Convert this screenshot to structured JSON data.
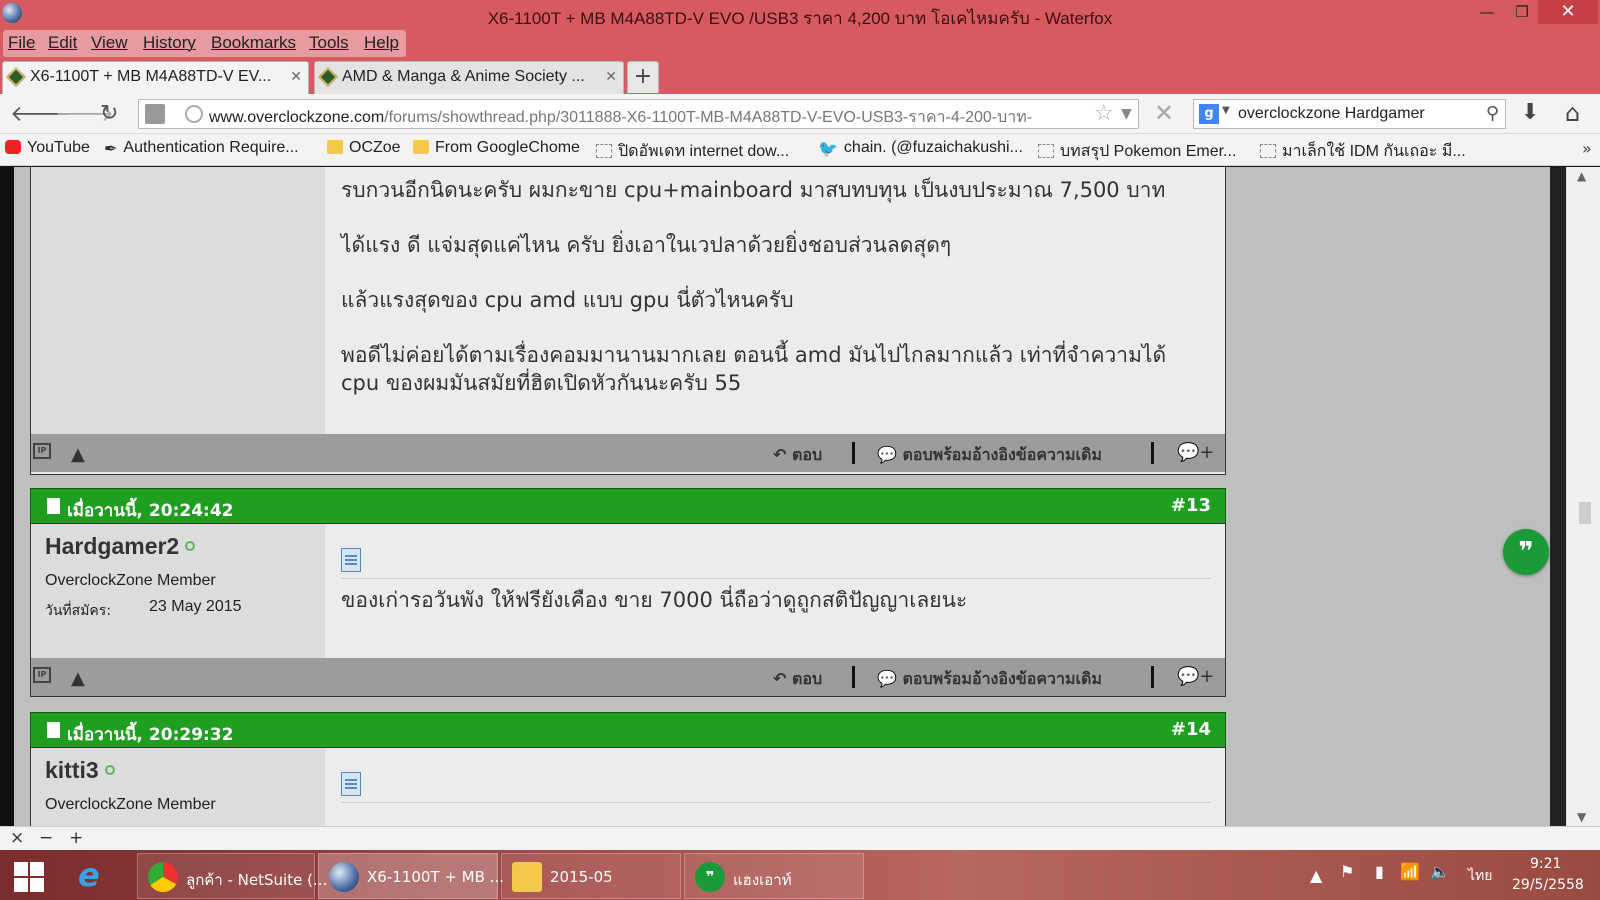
{
  "window": {
    "title": "X6-1100T + MB M4A88TD-V EVO /USB3 ราคา 4,200 บาท โอเคไหมครับ - Waterfox",
    "minimize": "—",
    "maximize": "❐",
    "close": "✕"
  },
  "menu": {
    "items": [
      "File",
      "Edit",
      "View",
      "History",
      "Bookmarks",
      "Tools",
      "Help"
    ]
  },
  "tabs": [
    {
      "label": "X6-1100T + MB M4A88TD-V EV...",
      "active": true
    },
    {
      "label": "AMD & Manga & Anime Society ...",
      "active": false
    }
  ],
  "new_tab": "+",
  "nav": {
    "back": "🡐",
    "forward": "🡒",
    "reload": "↻",
    "url_domain": "www.overclockzone.com",
    "url_rest": "/forums/showthread.php/3011888-X6-1100T-MB-M4A88TD-V-EVO-USB3-ราคา-4-200-บาท-",
    "stop": "✕",
    "search_text": "overclockzone Hardgamer",
    "search_engine_letter": "g"
  },
  "bookmarks": [
    {
      "label": "YouTube",
      "icon": "youtube-icon"
    },
    {
      "label": "Authentication Require...",
      "icon": "pen-icon"
    },
    {
      "label": "OCZoe",
      "icon": "folder-icon"
    },
    {
      "label": "From GoogleChome",
      "icon": "folder-icon"
    },
    {
      "label": "ปิดอัพเดท internet dow...",
      "icon": "blank-page-icon"
    },
    {
      "label": "chain. (@fuzaichakushi...",
      "icon": "twitter-icon"
    },
    {
      "label": "บทสรุป Pokemon Emer...",
      "icon": "blank-page-icon"
    },
    {
      "label": "มาเล็กใช้ IDM กันเถอะ มี...",
      "icon": "blank-page-icon"
    }
  ],
  "bookmarks_more": "»",
  "posts": [
    {
      "lines": [
        "รบกวนอีกนิดนะครับ ผมกะขาย cpu+mainboard มาสบทบทุน เป็นงบประมาณ 7,500 บาท",
        "ได้แรง ดี แจ่มสุดแค่ไหน ครับ ยิ่งเอาในเวปลาด้วยยิ่งชอบส่วนลดสุดๆ",
        "แล้วแรงสุดของ cpu amd แบบ gpu นี่ตัวไหนครับ",
        "พอดีไม่ค่อยได้ตามเรื่องคอมมานานมากเลย ตอนนี้ amd มันไปไกลมากแล้ว เท่าที่จำความได้",
        "cpu ของผมมันสมัยที่ฮิตเปิดหัวกันนะครับ 55"
      ]
    },
    {
      "date": "เมื่อวานนี้, 20:24:42",
      "number": "#13",
      "username": "Hardgamer2",
      "usertitle": "OverclockZone Member",
      "join_label": "วันที่สมัคร:",
      "join_date": "23 May 2015",
      "text": "ของเก่ารอวันพัง ให้ฟรียังเคือง ขาย 7000 นี่ถือว่าดูถูกสติปัญญาเลยนะ"
    },
    {
      "date": "เมื่อวานนี้, 20:29:32",
      "number": "#14",
      "username": "kitti3",
      "usertitle": "OverclockZone Member"
    }
  ],
  "footer_actions": {
    "reply": "ตอบ",
    "reply_quote": "ตอบพร้อมอ้างอิงข้อความเดิม"
  },
  "zoombar": {
    "close": "×",
    "zoom_out": "−",
    "zoom_in": "+"
  },
  "taskbar": {
    "tasks": [
      {
        "label": "ลูกค้า - NetSuite (...",
        "icon": "chrome-icon"
      },
      {
        "label": "X6-1100T + MB ...",
        "icon": "waterfox-icon"
      },
      {
        "label": "2015-05",
        "icon": "folder-icon"
      },
      {
        "label": "แฮงเอาท์",
        "icon": "hangouts-icon"
      }
    ],
    "language": "ไทย",
    "time": "9:21",
    "date": "29/5/2558"
  },
  "colors": {
    "titlebar": "#d75a60",
    "post_header_green": "#1f9e1f",
    "hangouts_green": "#1b9a3a"
  }
}
